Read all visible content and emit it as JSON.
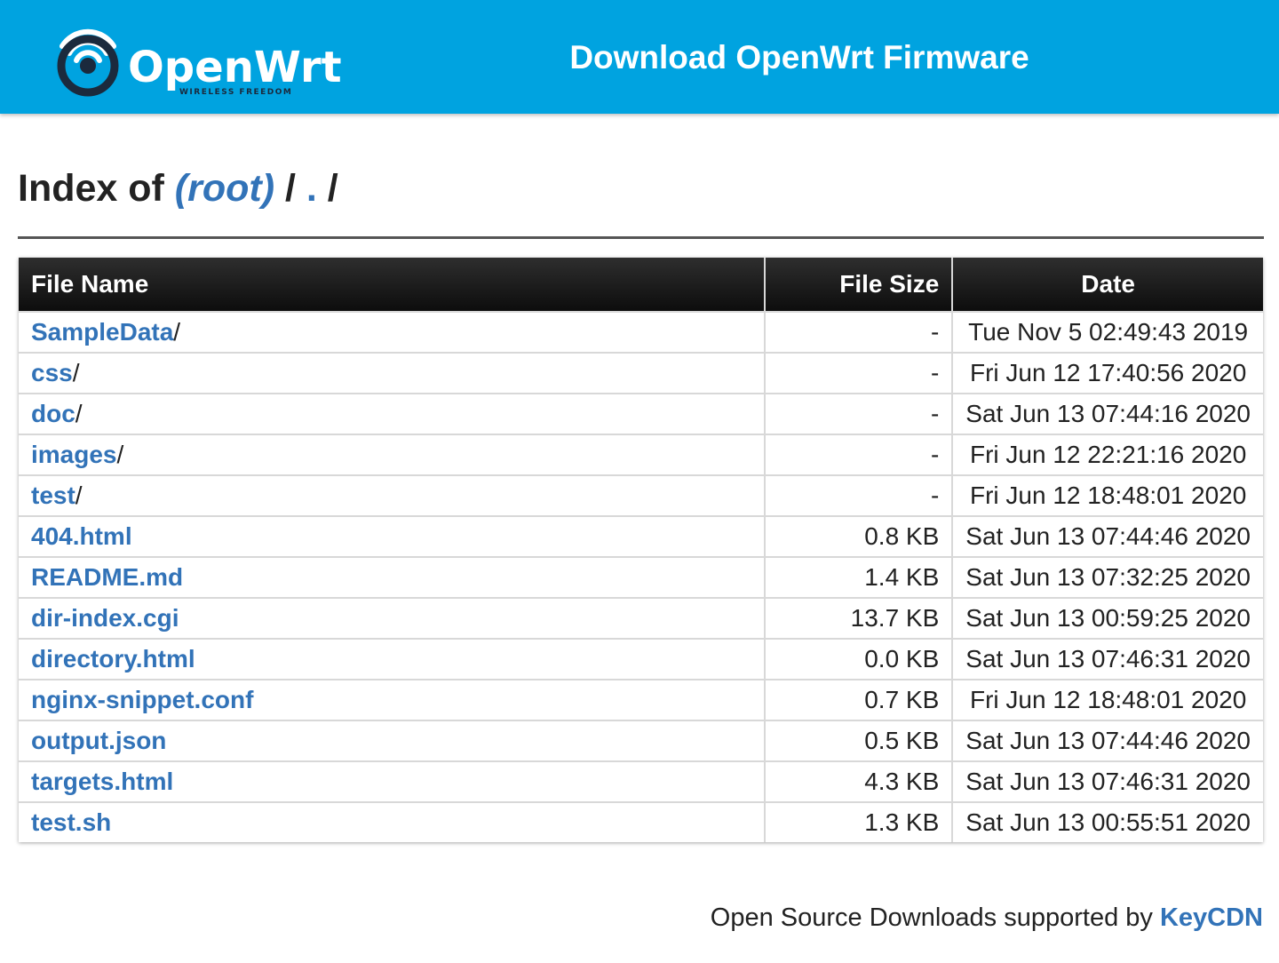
{
  "header": {
    "logo_wordmark": "OpenWrt",
    "logo_tagline": "WIRELESS FREEDOM",
    "title": "Download OpenWrt Firmware"
  },
  "breadcrumb": {
    "prefix": "Index of",
    "root_label": "(root)",
    "separator": "/",
    "current_label": "."
  },
  "table": {
    "columns": [
      "File Name",
      "File Size",
      "Date"
    ],
    "rows": [
      {
        "name": "SampleData",
        "dir": true,
        "size": "-",
        "date": "Tue Nov 5 02:49:43 2019"
      },
      {
        "name": "css",
        "dir": true,
        "size": "-",
        "date": "Fri Jun 12 17:40:56 2020"
      },
      {
        "name": "doc",
        "dir": true,
        "size": "-",
        "date": "Sat Jun 13 07:44:16 2020"
      },
      {
        "name": "images",
        "dir": true,
        "size": "-",
        "date": "Fri Jun 12 22:21:16 2020"
      },
      {
        "name": "test",
        "dir": true,
        "size": "-",
        "date": "Fri Jun 12 18:48:01 2020"
      },
      {
        "name": "404.html",
        "dir": false,
        "size": "0.8 KB",
        "date": "Sat Jun 13 07:44:46 2020"
      },
      {
        "name": "README.md",
        "dir": false,
        "size": "1.4 KB",
        "date": "Sat Jun 13 07:32:25 2020"
      },
      {
        "name": "dir-index.cgi",
        "dir": false,
        "size": "13.7 KB",
        "date": "Sat Jun 13 00:59:25 2020"
      },
      {
        "name": "directory.html",
        "dir": false,
        "size": "0.0 KB",
        "date": "Sat Jun 13 07:46:31 2020"
      },
      {
        "name": "nginx-snippet.conf",
        "dir": false,
        "size": "0.7 KB",
        "date": "Fri Jun 12 18:48:01 2020"
      },
      {
        "name": "output.json",
        "dir": false,
        "size": "0.5 KB",
        "date": "Sat Jun 13 07:44:46 2020"
      },
      {
        "name": "targets.html",
        "dir": false,
        "size": "4.3 KB",
        "date": "Sat Jun 13 07:46:31 2020"
      },
      {
        "name": "test.sh",
        "dir": false,
        "size": "1.3 KB",
        "date": "Sat Jun 13 00:55:51 2020"
      }
    ]
  },
  "footer": {
    "text": "Open Source Downloads supported by",
    "link_label": "KeyCDN"
  },
  "colors": {
    "header_bg": "#00a3e0",
    "link": "#3273b8",
    "logo_dark": "#1b2a3d"
  },
  "icons": {
    "logo": "openwrt-wifi-logo-icon"
  }
}
